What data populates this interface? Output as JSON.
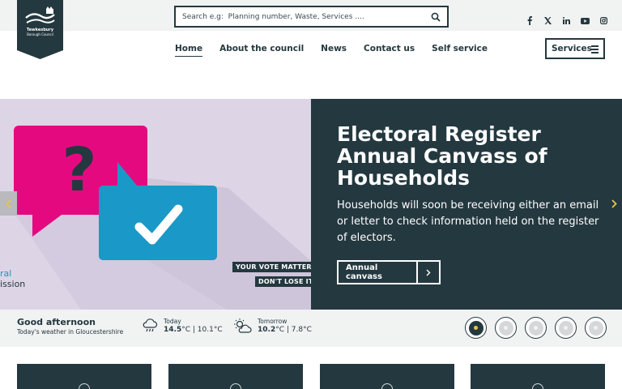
{
  "logo": {
    "name": "Tewkesbury",
    "sub": "Borough Council"
  },
  "search": {
    "placeholder": "Search e.g:  Planning number, Waste, Services ...."
  },
  "social": [
    "facebook-icon",
    "x-icon",
    "linkedin-icon",
    "youtube-icon",
    "instagram-icon"
  ],
  "nav": {
    "items": [
      "Home",
      "About the council",
      "News",
      "Contact us",
      "Self service"
    ],
    "active": "Home"
  },
  "services_button": {
    "label": "Services"
  },
  "hero": {
    "title": "Electoral Register Annual Canvass of Households",
    "description": "Households will soon be receiving either an email or letter to check information held on the register of electors.",
    "cta_label": "Annual canvass",
    "image": {
      "vote_line1": "YOUR VOTE MATTERS",
      "vote_line2": "DON'T LOSE IT",
      "commission_line1": "ral",
      "commission_line2": "ission"
    }
  },
  "weather": {
    "greeting": "Good afternoon",
    "location": "Today's weather in Gloucestershire",
    "today": {
      "label": "Today",
      "high": "14.5",
      "low": "10.1",
      "unit": "°C",
      "icon": "rain-cloud-icon"
    },
    "tomorrow": {
      "label": "Tomorrow",
      "high": "10.2",
      "low": "7.8",
      "unit": "°C",
      "icon": "sun-cloud-icon"
    }
  },
  "carousel": {
    "slides": 5,
    "active_index": 0
  },
  "colors": {
    "primary": "#24383f",
    "accent_pink": "#e5097f",
    "accent_blue": "#1a98c7",
    "bg_light": "#f1f2f2",
    "dot_active": "#e8c44a"
  }
}
